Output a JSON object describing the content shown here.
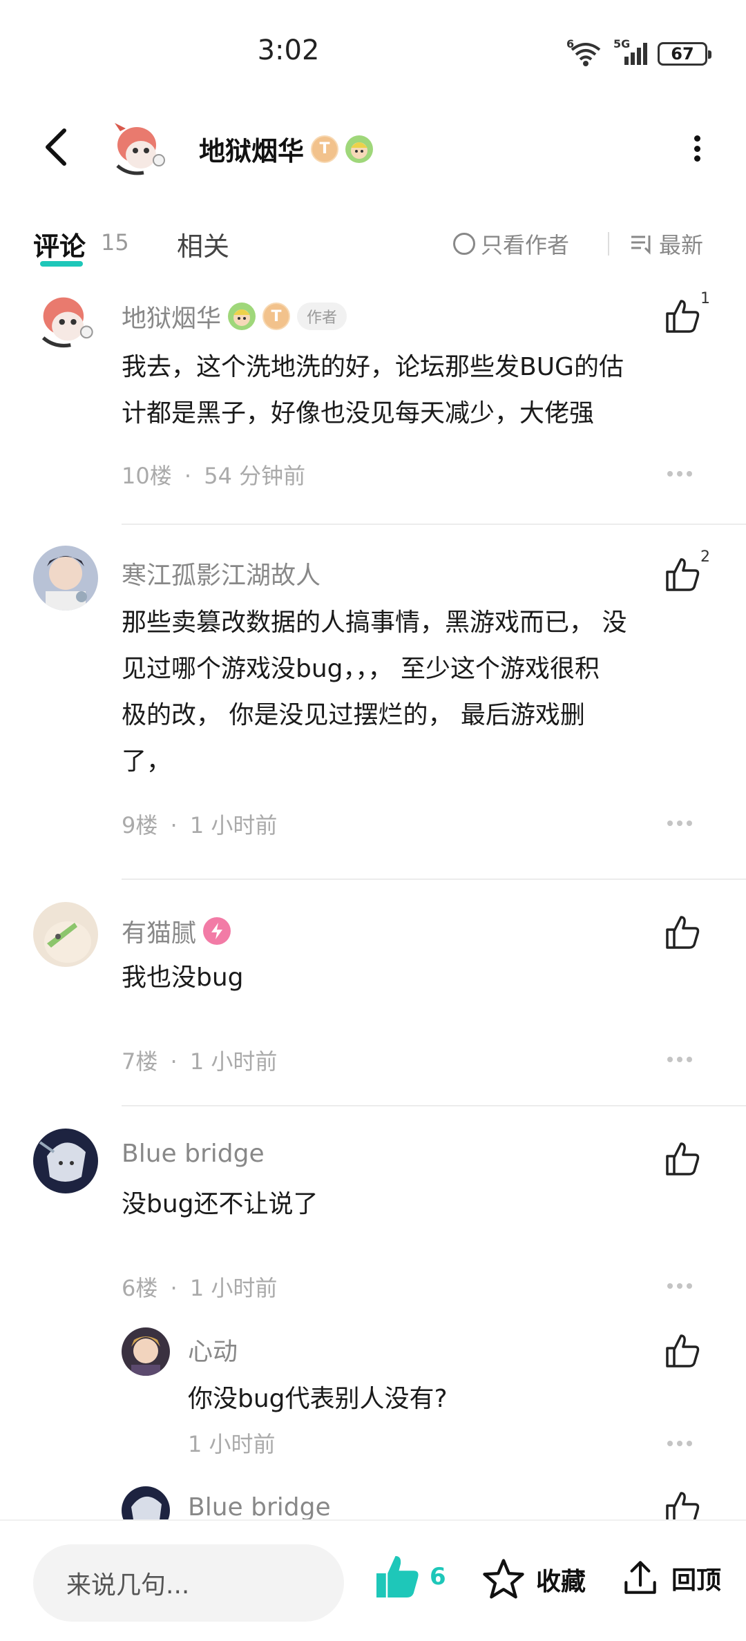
{
  "status": {
    "time": "3:02",
    "battery": "67",
    "network": "5G",
    "wifi_badge": "6"
  },
  "header": {
    "title": "地狱烟华",
    "badge_t": "T"
  },
  "tabs": {
    "comments_label": "评论",
    "comments_count": "15",
    "related_label": "相关",
    "only_author_label": "只看作者",
    "sort_label": "最新"
  },
  "comments": [
    {
      "name": "地狱烟华",
      "author_tag": "作者",
      "text_lines": [
        "我去，这个洗地洗的好，论坛那些发BUG的估",
        "计都是黑子，好像也没见每天减少，大佬强"
      ],
      "floor": "10楼",
      "time": "54 分钟前",
      "likes": "1"
    },
    {
      "name": "寒江孤影江湖故人",
      "text_lines": [
        "那些卖篡改数据的人搞事情，黑游戏而已， 没",
        "见过哪个游戏没bug，，，  至少这个游戏很积",
        "极的改，  你是没见过摆烂的，  最后游戏删",
        "了，"
      ],
      "floor": "9楼",
      "time": "1 小时前",
      "likes": "2"
    },
    {
      "name": "有猫腻",
      "text_lines": [
        "我也没bug"
      ],
      "floor": "7楼",
      "time": "1 小时前",
      "likes": ""
    },
    {
      "name": "Blue bridge",
      "text_lines": [
        "没bug还不让说了"
      ],
      "floor": "6楼",
      "time": "1 小时前",
      "likes": ""
    }
  ],
  "replies": [
    {
      "name": "心动",
      "text": "你没bug代表别人没有?",
      "time": "1 小时前"
    },
    {
      "name": "Blue bridge"
    }
  ],
  "separator": "·",
  "bottom_bar": {
    "input_placeholder": "来说几句...",
    "like_count": "6",
    "favorite_label": "收藏",
    "top_label": "回顶"
  },
  "colors": {
    "accent": "#1ec7b9",
    "meta_gray": "#aaaaaa",
    "name_gray": "#888888"
  }
}
